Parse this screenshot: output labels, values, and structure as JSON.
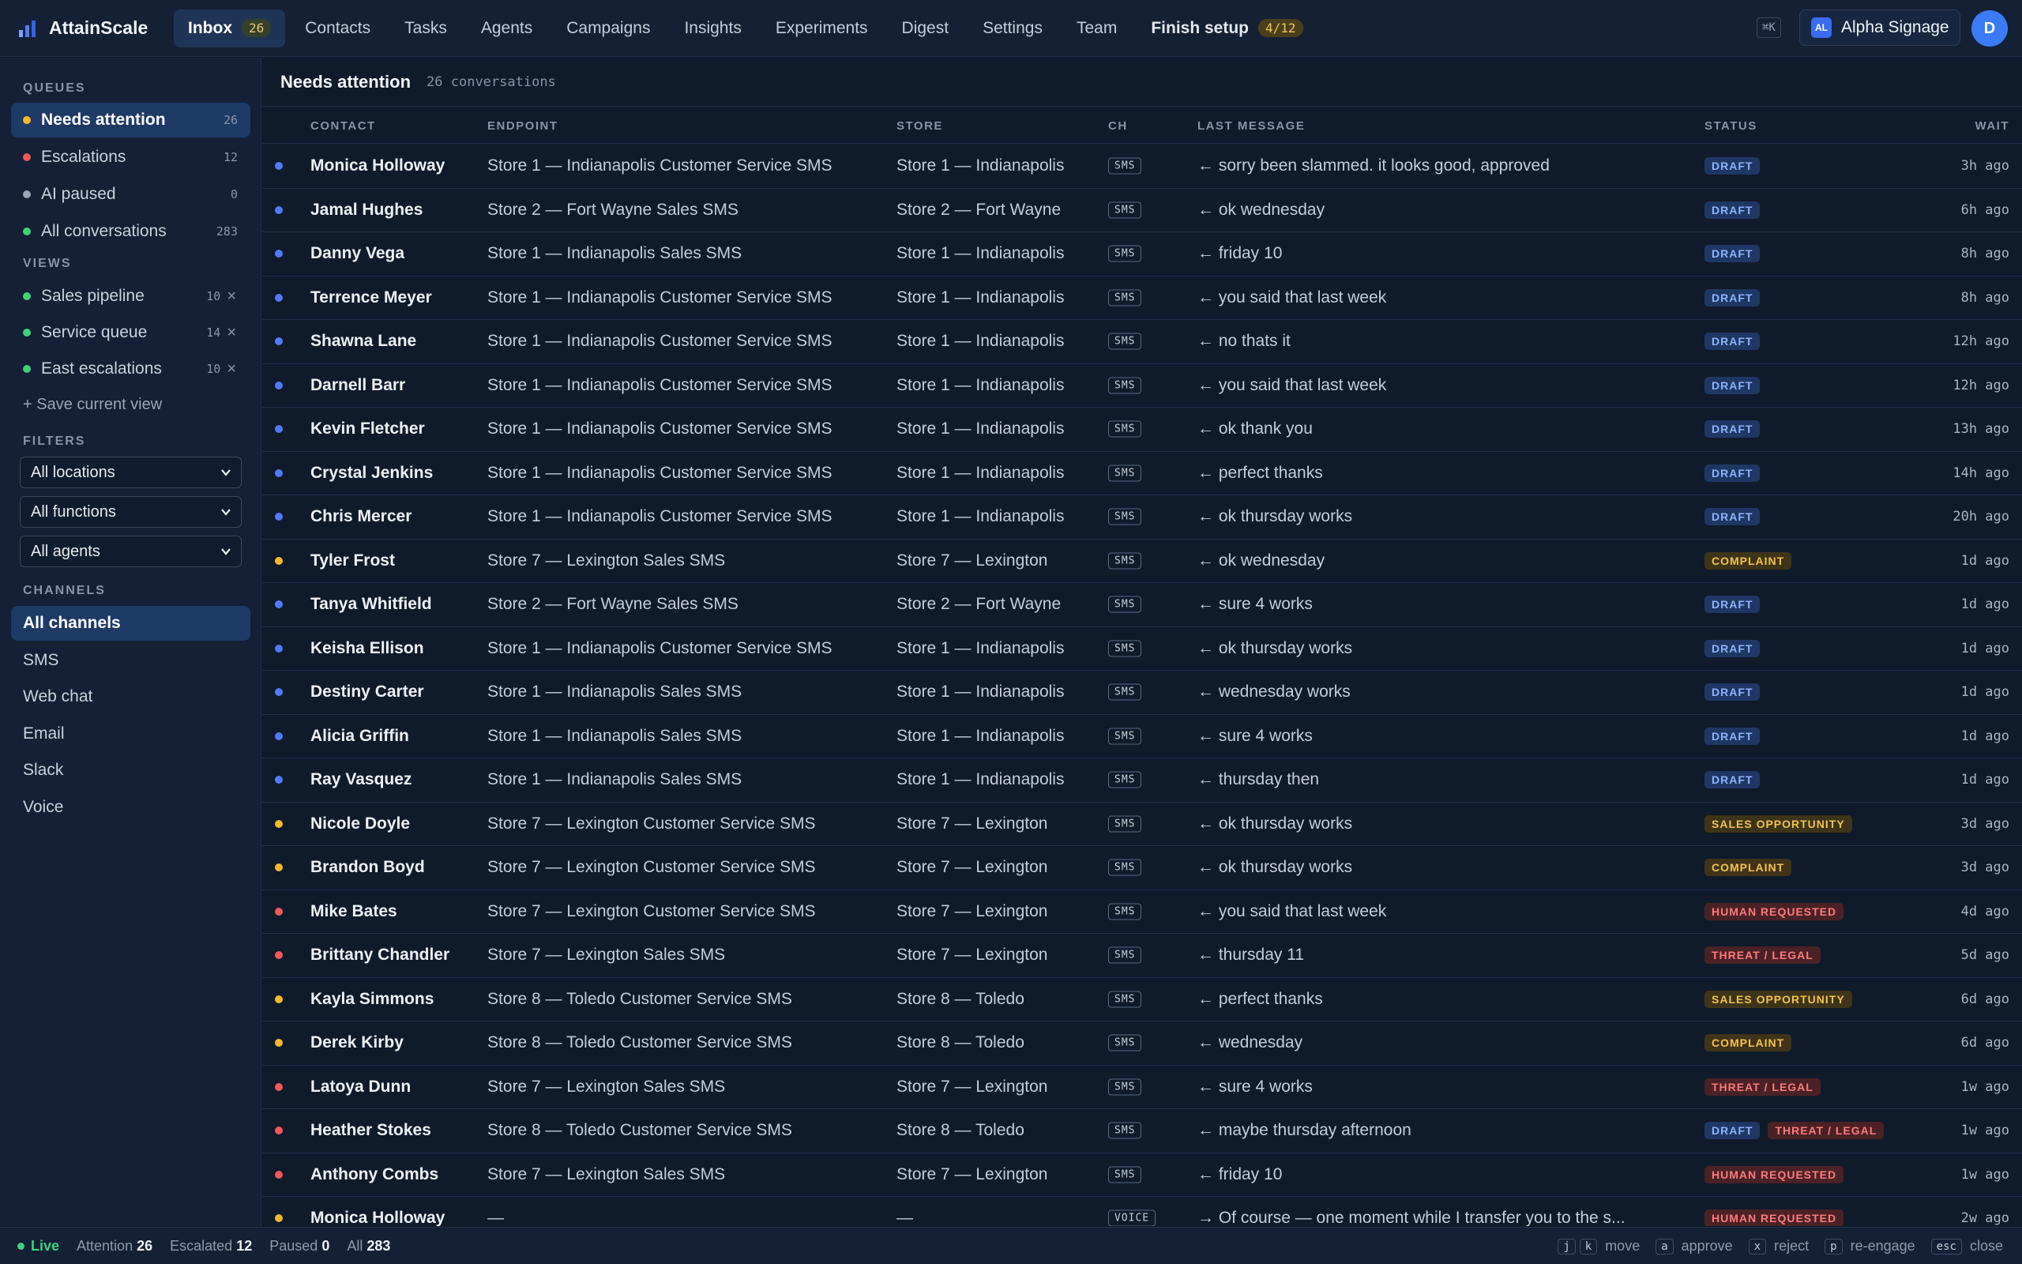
{
  "app": {
    "name": "AttainScale"
  },
  "nav": [
    {
      "label": "Inbox",
      "badge": "26",
      "active": true
    },
    {
      "label": "Contacts"
    },
    {
      "label": "Tasks"
    },
    {
      "label": "Agents"
    },
    {
      "label": "Campaigns"
    },
    {
      "label": "Insights"
    },
    {
      "label": "Experiments"
    },
    {
      "label": "Digest"
    },
    {
      "label": "Settings"
    },
    {
      "label": "Team"
    }
  ],
  "setup": {
    "label": "Finish setup",
    "badge": "4/12"
  },
  "shortcut": "⌘K",
  "org": {
    "initials": "AL",
    "name": "Alpha Signage"
  },
  "user": {
    "initial": "D"
  },
  "sidebar": {
    "queues_title": "QUEUES",
    "queues": [
      {
        "label": "Needs attention",
        "count": "26",
        "color": "#f5b82e",
        "active": true
      },
      {
        "label": "Escalations",
        "count": "12",
        "color": "#ef5a5a"
      },
      {
        "label": "AI paused",
        "count": "0",
        "color": "#9aa6b8"
      },
      {
        "label": "All conversations",
        "count": "283",
        "color": "#3fd27a"
      }
    ],
    "views_title": "VIEWS",
    "views": [
      {
        "label": "Sales pipeline",
        "count": "10",
        "color": "#3fd27a"
      },
      {
        "label": "Service queue",
        "count": "14",
        "color": "#3fd27a"
      },
      {
        "label": "East escalations",
        "count": "10",
        "color": "#3fd27a"
      }
    ],
    "save_view": "+ Save current view",
    "filters_title": "FILTERS",
    "filters": [
      "All locations",
      "All functions",
      "All agents"
    ],
    "channels_title": "CHANNELS",
    "channels": [
      {
        "label": "All channels",
        "active": true
      },
      {
        "label": "SMS"
      },
      {
        "label": "Web chat"
      },
      {
        "label": "Email"
      },
      {
        "label": "Slack"
      },
      {
        "label": "Voice"
      }
    ]
  },
  "main": {
    "title": "Needs attention",
    "subtitle": "26 conversations",
    "columns": {
      "contact": "CONTACT",
      "endpoint": "ENDPOINT",
      "store": "STORE",
      "ch": "CH",
      "last_message": "LAST MESSAGE",
      "status": "STATUS",
      "wait": "WAIT"
    }
  },
  "status_styles": {
    "DRAFT": {
      "bg": "#1f3763",
      "fg": "#8fb2ff"
    },
    "COMPLAINT": {
      "bg": "#3f3418",
      "fg": "#f2c34e"
    },
    "SALES OPPORTUNITY": {
      "bg": "#3f3418",
      "fg": "#f2c34e"
    },
    "HUMAN REQUESTED": {
      "bg": "#4a2226",
      "fg": "#ff7a7a"
    },
    "THREAT / LEGAL": {
      "bg": "#4a2226",
      "fg": "#ff7a7a"
    }
  },
  "dot_colors": {
    "blue": "#4f7cf6",
    "yellow": "#f5b82e",
    "red": "#ef5a5a"
  },
  "rows": [
    {
      "dot": "blue",
      "contact": "Monica Holloway",
      "endpoint": "Store 1 — Indianapolis Customer Service SMS",
      "store": "Store 1 — Indianapolis",
      "ch": "SMS",
      "msg": "← sorry been slammed. it looks good, approved",
      "status": [
        "DRAFT"
      ],
      "wait": "3h ago"
    },
    {
      "dot": "blue",
      "contact": "Jamal Hughes",
      "endpoint": "Store 2 — Fort Wayne Sales SMS",
      "store": "Store 2 — Fort Wayne",
      "ch": "SMS",
      "msg": "← ok wednesday",
      "status": [
        "DRAFT"
      ],
      "wait": "6h ago"
    },
    {
      "dot": "blue",
      "contact": "Danny Vega",
      "endpoint": "Store 1 — Indianapolis Sales SMS",
      "store": "Store 1 — Indianapolis",
      "ch": "SMS",
      "msg": "← friday 10",
      "status": [
        "DRAFT"
      ],
      "wait": "8h ago"
    },
    {
      "dot": "blue",
      "contact": "Terrence Meyer",
      "endpoint": "Store 1 — Indianapolis Customer Service SMS",
      "store": "Store 1 — Indianapolis",
      "ch": "SMS",
      "msg": "← you said that last week",
      "status": [
        "DRAFT"
      ],
      "wait": "8h ago"
    },
    {
      "dot": "blue",
      "contact": "Shawna Lane",
      "endpoint": "Store 1 — Indianapolis Customer Service SMS",
      "store": "Store 1 — Indianapolis",
      "ch": "SMS",
      "msg": "← no thats it",
      "status": [
        "DRAFT"
      ],
      "wait": "12h ago"
    },
    {
      "dot": "blue",
      "contact": "Darnell Barr",
      "endpoint": "Store 1 — Indianapolis Customer Service SMS",
      "store": "Store 1 — Indianapolis",
      "ch": "SMS",
      "msg": "← you said that last week",
      "status": [
        "DRAFT"
      ],
      "wait": "12h ago"
    },
    {
      "dot": "blue",
      "contact": "Kevin Fletcher",
      "endpoint": "Store 1 — Indianapolis Customer Service SMS",
      "store": "Store 1 — Indianapolis",
      "ch": "SMS",
      "msg": "← ok thank you",
      "status": [
        "DRAFT"
      ],
      "wait": "13h ago"
    },
    {
      "dot": "blue",
      "contact": "Crystal Jenkins",
      "endpoint": "Store 1 — Indianapolis Customer Service SMS",
      "store": "Store 1 — Indianapolis",
      "ch": "SMS",
      "msg": "← perfect thanks",
      "status": [
        "DRAFT"
      ],
      "wait": "14h ago"
    },
    {
      "dot": "blue",
      "contact": "Chris Mercer",
      "endpoint": "Store 1 — Indianapolis Customer Service SMS",
      "store": "Store 1 — Indianapolis",
      "ch": "SMS",
      "msg": "← ok thursday works",
      "status": [
        "DRAFT"
      ],
      "wait": "20h ago"
    },
    {
      "dot": "yellow",
      "contact": "Tyler Frost",
      "endpoint": "Store 7 — Lexington Sales SMS",
      "store": "Store 7 — Lexington",
      "ch": "SMS",
      "msg": "← ok wednesday",
      "status": [
        "COMPLAINT"
      ],
      "wait": "1d ago"
    },
    {
      "dot": "blue",
      "contact": "Tanya Whitfield",
      "endpoint": "Store 2 — Fort Wayne Sales SMS",
      "store": "Store 2 — Fort Wayne",
      "ch": "SMS",
      "msg": "← sure 4 works",
      "status": [
        "DRAFT"
      ],
      "wait": "1d ago"
    },
    {
      "dot": "blue",
      "contact": "Keisha Ellison",
      "endpoint": "Store 1 — Indianapolis Customer Service SMS",
      "store": "Store 1 — Indianapolis",
      "ch": "SMS",
      "msg": "← ok thursday works",
      "status": [
        "DRAFT"
      ],
      "wait": "1d ago"
    },
    {
      "dot": "blue",
      "contact": "Destiny Carter",
      "endpoint": "Store 1 — Indianapolis Sales SMS",
      "store": "Store 1 — Indianapolis",
      "ch": "SMS",
      "msg": "← wednesday works",
      "status": [
        "DRAFT"
      ],
      "wait": "1d ago"
    },
    {
      "dot": "blue",
      "contact": "Alicia Griffin",
      "endpoint": "Store 1 — Indianapolis Sales SMS",
      "store": "Store 1 — Indianapolis",
      "ch": "SMS",
      "msg": "← sure 4 works",
      "status": [
        "DRAFT"
      ],
      "wait": "1d ago"
    },
    {
      "dot": "blue",
      "contact": "Ray Vasquez",
      "endpoint": "Store 1 — Indianapolis Sales SMS",
      "store": "Store 1 — Indianapolis",
      "ch": "SMS",
      "msg": "← thursday then",
      "status": [
        "DRAFT"
      ],
      "wait": "1d ago"
    },
    {
      "dot": "yellow",
      "contact": "Nicole Doyle",
      "endpoint": "Store 7 — Lexington Customer Service SMS",
      "store": "Store 7 — Lexington",
      "ch": "SMS",
      "msg": "← ok thursday works",
      "status": [
        "SALES OPPORTUNITY"
      ],
      "wait": "3d ago"
    },
    {
      "dot": "yellow",
      "contact": "Brandon Boyd",
      "endpoint": "Store 7 — Lexington Customer Service SMS",
      "store": "Store 7 — Lexington",
      "ch": "SMS",
      "msg": "← ok thursday works",
      "status": [
        "COMPLAINT"
      ],
      "wait": "3d ago"
    },
    {
      "dot": "red",
      "contact": "Mike Bates",
      "endpoint": "Store 7 — Lexington Customer Service SMS",
      "store": "Store 7 — Lexington",
      "ch": "SMS",
      "msg": "← you said that last week",
      "status": [
        "HUMAN REQUESTED"
      ],
      "wait": "4d ago"
    },
    {
      "dot": "red",
      "contact": "Brittany Chandler",
      "endpoint": "Store 7 — Lexington Sales SMS",
      "store": "Store 7 — Lexington",
      "ch": "SMS",
      "msg": "← thursday 11",
      "status": [
        "THREAT / LEGAL"
      ],
      "wait": "5d ago"
    },
    {
      "dot": "yellow",
      "contact": "Kayla Simmons",
      "endpoint": "Store 8 — Toledo Customer Service SMS",
      "store": "Store 8 — Toledo",
      "ch": "SMS",
      "msg": "← perfect thanks",
      "status": [
        "SALES OPPORTUNITY"
      ],
      "wait": "6d ago"
    },
    {
      "dot": "yellow",
      "contact": "Derek Kirby",
      "endpoint": "Store 8 — Toledo Customer Service SMS",
      "store": "Store 8 — Toledo",
      "ch": "SMS",
      "msg": "← wednesday",
      "status": [
        "COMPLAINT"
      ],
      "wait": "6d ago"
    },
    {
      "dot": "red",
      "contact": "Latoya Dunn",
      "endpoint": "Store 7 — Lexington Sales SMS",
      "store": "Store 7 — Lexington",
      "ch": "SMS",
      "msg": "← sure 4 works",
      "status": [
        "THREAT / LEGAL"
      ],
      "wait": "1w ago"
    },
    {
      "dot": "red",
      "contact": "Heather Stokes",
      "endpoint": "Store 8 — Toledo Customer Service SMS",
      "store": "Store 8 — Toledo",
      "ch": "SMS",
      "msg": "← maybe thursday afternoon",
      "status": [
        "DRAFT",
        "THREAT / LEGAL"
      ],
      "wait": "1w ago"
    },
    {
      "dot": "red",
      "contact": "Anthony Combs",
      "endpoint": "Store 7 — Lexington Sales SMS",
      "store": "Store 7 — Lexington",
      "ch": "SMS",
      "msg": "← friday 10",
      "status": [
        "HUMAN REQUESTED"
      ],
      "wait": "1w ago"
    },
    {
      "dot": "yellow",
      "contact": "Monica Holloway",
      "endpoint": "—",
      "store": "—",
      "ch": "VOICE",
      "msg": "→ Of course — one moment while I transfer you to the s...",
      "status": [
        "HUMAN REQUESTED"
      ],
      "wait": "2w ago"
    }
  ],
  "footer": {
    "live": "Live",
    "stats": [
      {
        "label": "Attention",
        "value": "26"
      },
      {
        "label": "Escalated",
        "value": "12"
      },
      {
        "label": "Paused",
        "value": "0"
      },
      {
        "label": "All",
        "value": "283"
      }
    ],
    "hints": [
      {
        "keys": [
          "j",
          "k"
        ],
        "label": "move"
      },
      {
        "keys": [
          "a"
        ],
        "label": "approve"
      },
      {
        "keys": [
          "x"
        ],
        "label": "reject"
      },
      {
        "keys": [
          "p"
        ],
        "label": "re-engage"
      },
      {
        "keys": [
          "esc"
        ],
        "label": "close"
      }
    ]
  }
}
